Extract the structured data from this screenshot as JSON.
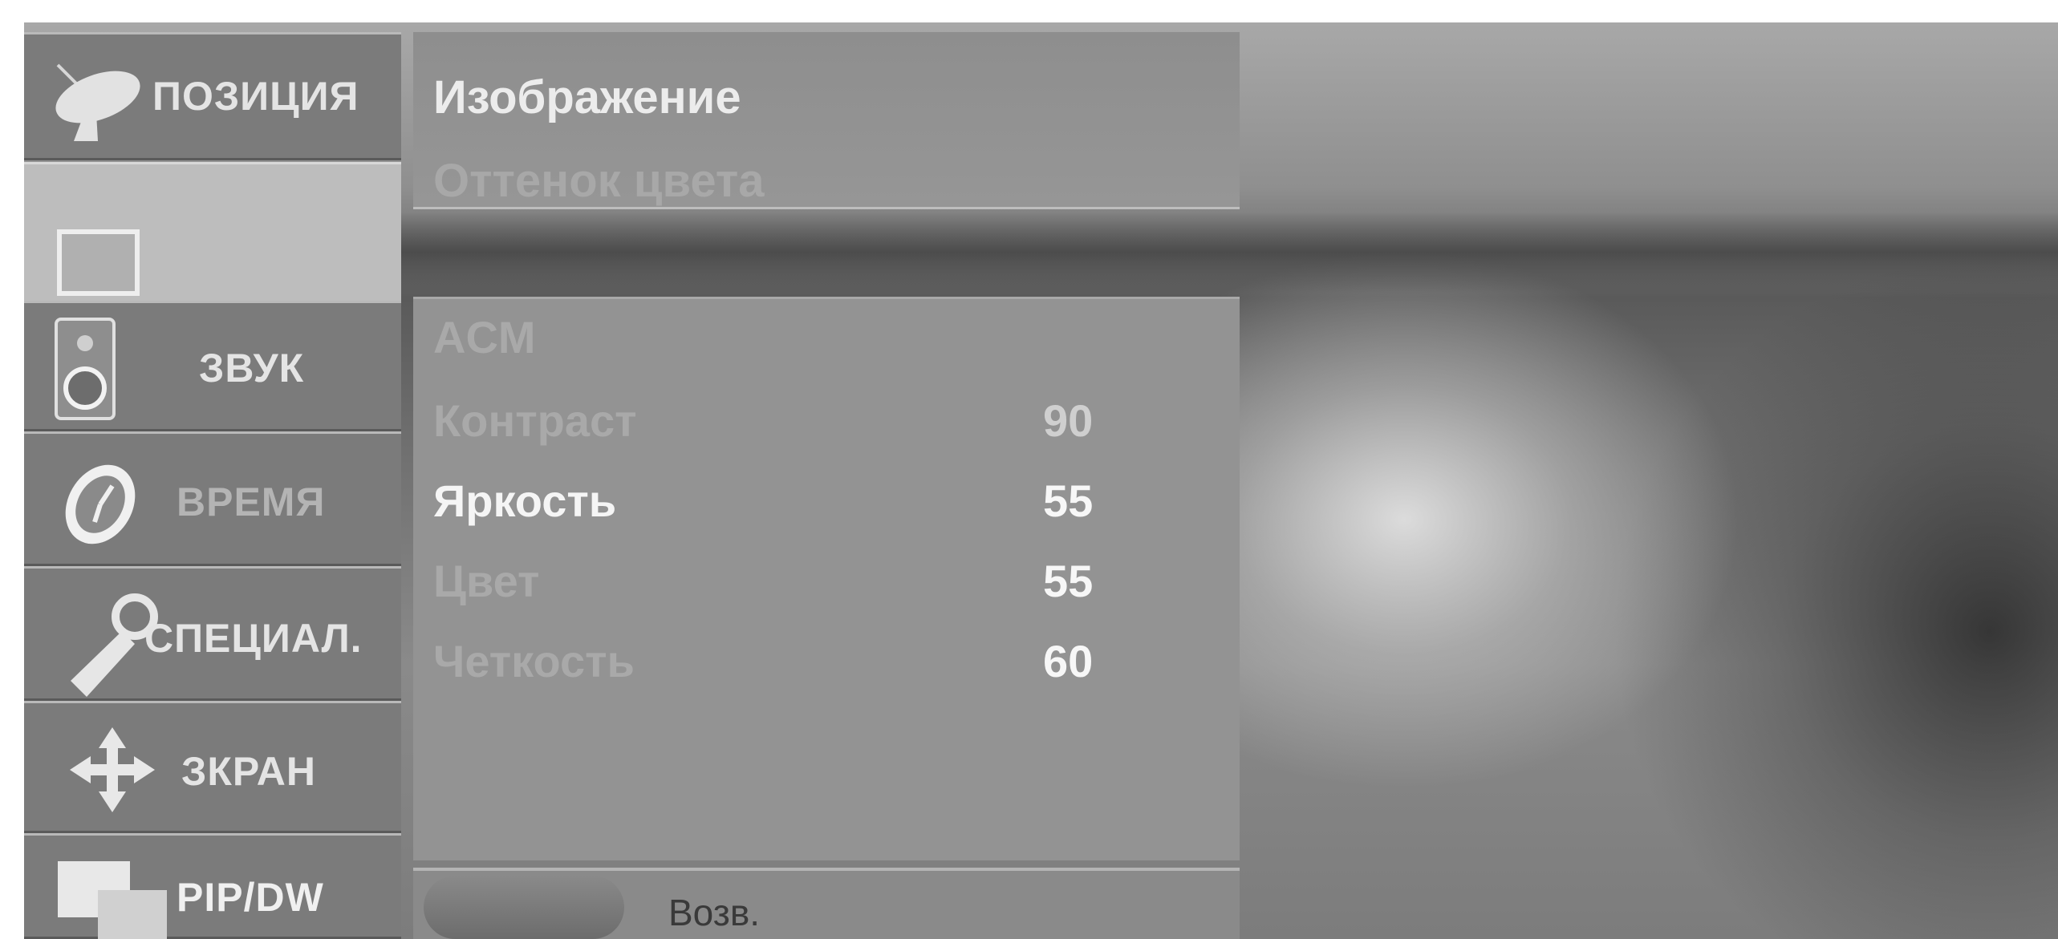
{
  "sidebar": {
    "items": [
      {
        "label": "ПОЗИЦИЯ",
        "icon": "satellite-dish-icon"
      },
      {
        "label": "",
        "icon": "picture-icon",
        "selected": true
      },
      {
        "label": "ЗВУК",
        "icon": "speaker-icon"
      },
      {
        "label": "ВРЕМЯ",
        "icon": "clock-icon"
      },
      {
        "label": "СПЕЦИАЛ.",
        "icon": "key-icon"
      },
      {
        "label": "ЗКРАН",
        "icon": "move-arrows-icon"
      },
      {
        "label": "PIP/DW",
        "icon": "pip-icon"
      }
    ]
  },
  "menu": {
    "title": "Изображение",
    "sub": "Оттенок цвета",
    "rows": [
      {
        "label": "ACM",
        "value": ""
      },
      {
        "label": "Контраст",
        "value": "90"
      },
      {
        "label": "Яркость",
        "value": "55"
      },
      {
        "label": "Цвет",
        "value": "55"
      },
      {
        "label": "Четкость",
        "value": "60"
      }
    ]
  },
  "footer": {
    "back_label": "Возв."
  }
}
